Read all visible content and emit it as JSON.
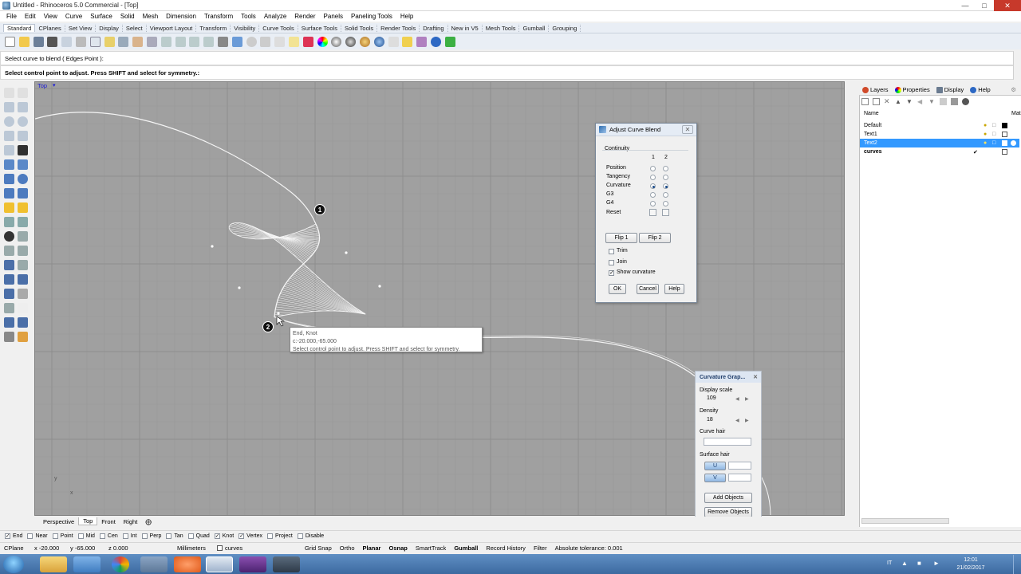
{
  "window": {
    "title": "Untitled - Rhinoceros 5.0 Commercial - [Top]"
  },
  "menu": [
    "File",
    "Edit",
    "View",
    "Curve",
    "Surface",
    "Solid",
    "Mesh",
    "Dimension",
    "Transform",
    "Tools",
    "Analyze",
    "Render",
    "Panels",
    "Paneling Tools",
    "Help"
  ],
  "toolbar_tabs": [
    "Standard",
    "CPlanes",
    "Set View",
    "Display",
    "Select",
    "Viewport Layout",
    "Transform",
    "Visibility",
    "Curve Tools",
    "Surface Tools",
    "Solid Tools",
    "Render Tools",
    "Drafting",
    "New in V5",
    "Mesh Tools",
    "Gumball",
    "Grouping"
  ],
  "command": {
    "history": "Select curve to blend ( Edges  Point ):",
    "prompt": "Select control point to adjust. Press SHIFT and select for symmetry.:"
  },
  "viewport": {
    "label": "Top",
    "axis_y": "y",
    "axis_x": "x"
  },
  "markers": [
    "1",
    "2"
  ],
  "tooltip": {
    "line1": "End, Knot",
    "line2": "c:-20.000,-65.000",
    "line3": "Select control point to adjust. Press SHIFT and select for symmetry."
  },
  "blend_dialog": {
    "title": "Adjust Curve Blend",
    "continuity_label": "Continuity",
    "col1": "1",
    "col2": "2",
    "rows": [
      "Position",
      "Tangency",
      "Curvature",
      "G3",
      "G4",
      "Reset"
    ],
    "selected_row": "Curvature",
    "flip1": "Flip 1",
    "flip2": "Flip 2",
    "trim": "Trim",
    "join": "Join",
    "show_curvature": "Show curvature",
    "show_curvature_checked": true,
    "ok": "OK",
    "cancel": "Cancel",
    "help": "Help"
  },
  "curvature_graph": {
    "title": "Curvature Grap...",
    "display_scale_label": "Display scale",
    "display_scale": "109",
    "density_label": "Density",
    "density": "18",
    "curve_hair_label": "Curve hair",
    "surface_hair_label": "Surface hair",
    "u": "U",
    "v": "V",
    "add_objects": "Add Objects",
    "remove_objects": "Remove Objects"
  },
  "panel": {
    "tabs": [
      "Layers",
      "Properties",
      "Display",
      "Help"
    ],
    "column_name": "Name",
    "column_mat": "Mat",
    "layers": [
      {
        "name": "Default",
        "selected": false
      },
      {
        "name": "Text1",
        "selected": false
      },
      {
        "name": "Text2",
        "selected": true
      },
      {
        "name": "curves",
        "selected": false,
        "current": true
      }
    ]
  },
  "viewport_tabs": [
    "Perspective",
    "Top",
    "Front",
    "Right"
  ],
  "active_viewport_tab": "Top",
  "osnaps": [
    {
      "label": "End",
      "checked": true
    },
    {
      "label": "Near",
      "checked": false
    },
    {
      "label": "Point",
      "checked": false
    },
    {
      "label": "Mid",
      "checked": false
    },
    {
      "label": "Cen",
      "checked": false
    },
    {
      "label": "Int",
      "checked": false
    },
    {
      "label": "Perp",
      "checked": false
    },
    {
      "label": "Tan",
      "checked": false
    },
    {
      "label": "Quad",
      "checked": false
    },
    {
      "label": "Knot",
      "checked": true
    },
    {
      "label": "Vertex",
      "checked": true
    },
    {
      "label": "Project",
      "checked": false
    },
    {
      "label": "Disable",
      "checked": false
    }
  ],
  "status": {
    "cplane": "CPlane",
    "x": "x -20.000",
    "y": "y -65.000",
    "z": "z 0.000",
    "units": "Millimeters",
    "layer": "curves",
    "grid_snap": "Grid Snap",
    "ortho": "Ortho",
    "planar": "Planar",
    "osnap": "Osnap",
    "smarttrack": "SmartTrack",
    "gumball": "Gumball",
    "record_history": "Record History",
    "filter": "Filter",
    "tolerance": "Absolute tolerance: 0.001"
  },
  "taskbar": {
    "lang": "IT",
    "time": "12:01",
    "date": "21/02/2017"
  },
  "colors": {
    "viewport_bg": "#a0a0a0",
    "selection": "#3399ff",
    "taskbar": "#4a7ab2"
  }
}
